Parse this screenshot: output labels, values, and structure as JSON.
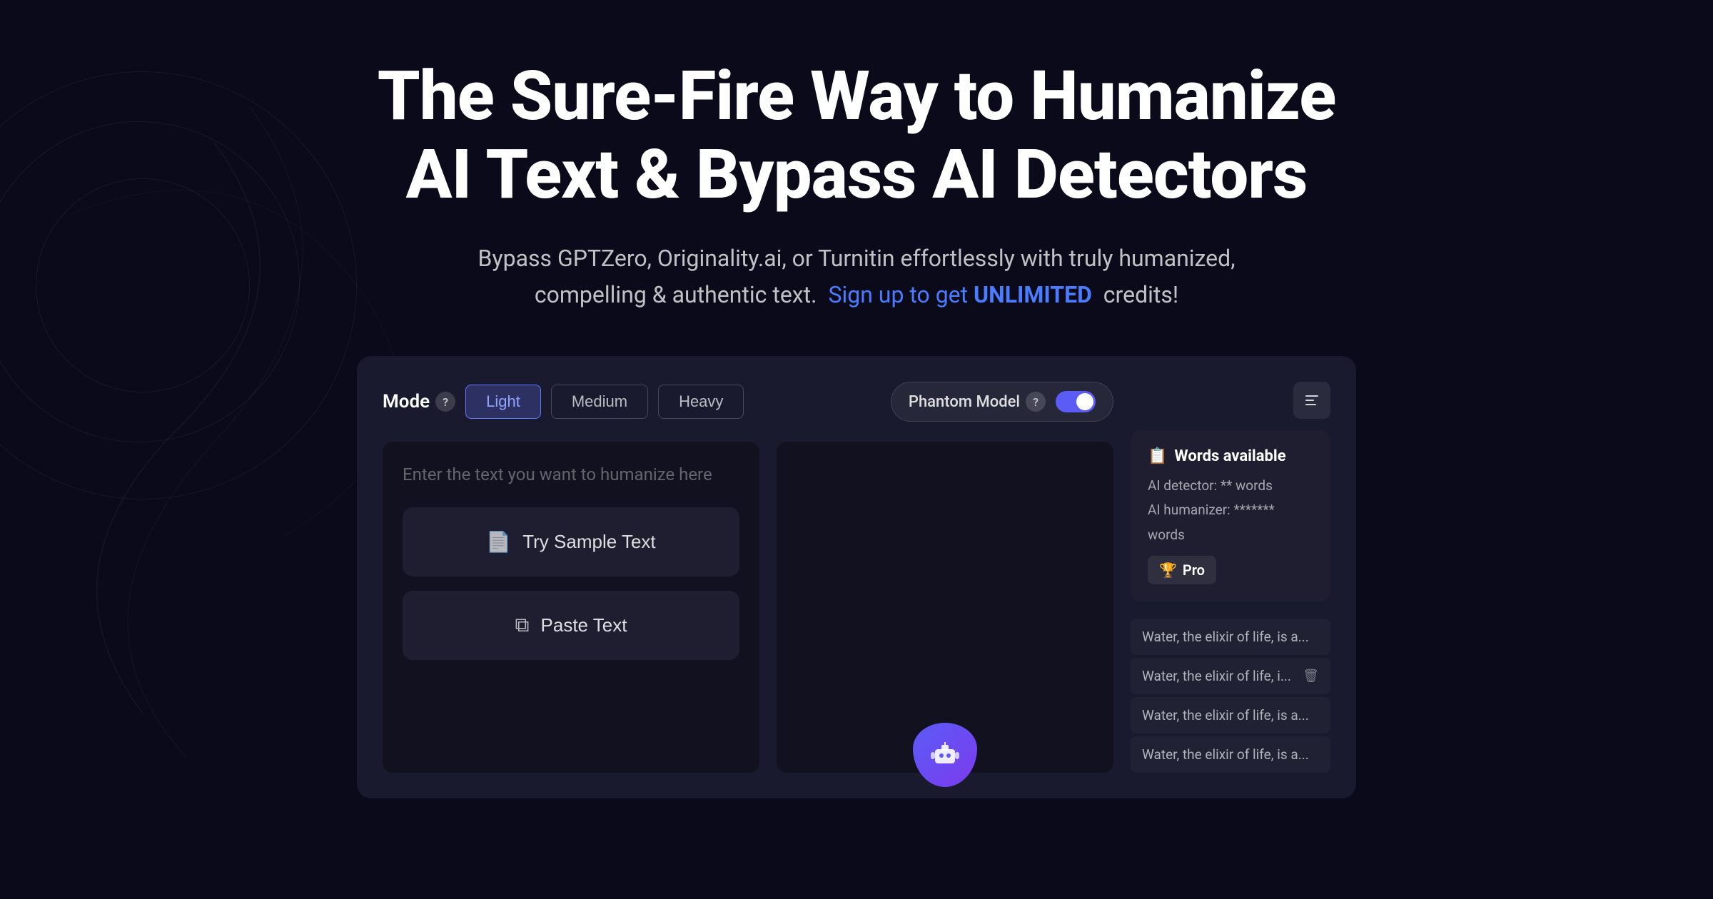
{
  "hero": {
    "title_line1": "The Sure-Fire Way to Humanize",
    "title_line2": "AI Text & Bypass AI Detectors",
    "subtitle_before": "Bypass GPTZero, Originality.ai, or Turnitin effortlessly with truly humanized,",
    "subtitle_line2_before": "compelling & authentic text.",
    "subtitle_signup": "Sign up to get",
    "subtitle_highlight": "UNLIMITED",
    "subtitle_after": "credits!"
  },
  "mode": {
    "label": "Mode",
    "help_icon": "?",
    "buttons": [
      {
        "id": "light",
        "label": "Light",
        "active": true
      },
      {
        "id": "medium",
        "label": "Medium",
        "active": false
      },
      {
        "id": "heavy",
        "label": "Heavy",
        "active": false
      }
    ],
    "phantom_label": "Phantom Model",
    "phantom_help": "?",
    "phantom_enabled": true
  },
  "input": {
    "placeholder": "Enter the text you want to humanize here",
    "try_sample_label": "Try Sample Text",
    "paste_label": "Paste Text"
  },
  "sidebar": {
    "words_title": "Words available",
    "words_icon": "📋",
    "detector_label": "AI detector:",
    "detector_value": "** words",
    "humanizer_label": "AI humanizer:",
    "humanizer_value": "******* words",
    "pro_label": "Pro",
    "history": [
      {
        "text": "Water, the elixir of life, is a...",
        "has_delete": false
      },
      {
        "text": "Water, the elixir of life, i...",
        "has_delete": true
      },
      {
        "text": "Water, the elixir of life, is a...",
        "has_delete": false
      },
      {
        "text": "Water, the elixir of life, is a...",
        "has_delete": false
      }
    ]
  },
  "icons": {
    "menu": "≡",
    "document": "📄",
    "clipboard": "⧉",
    "pro_icon": "🏆",
    "delete": "🗑"
  }
}
